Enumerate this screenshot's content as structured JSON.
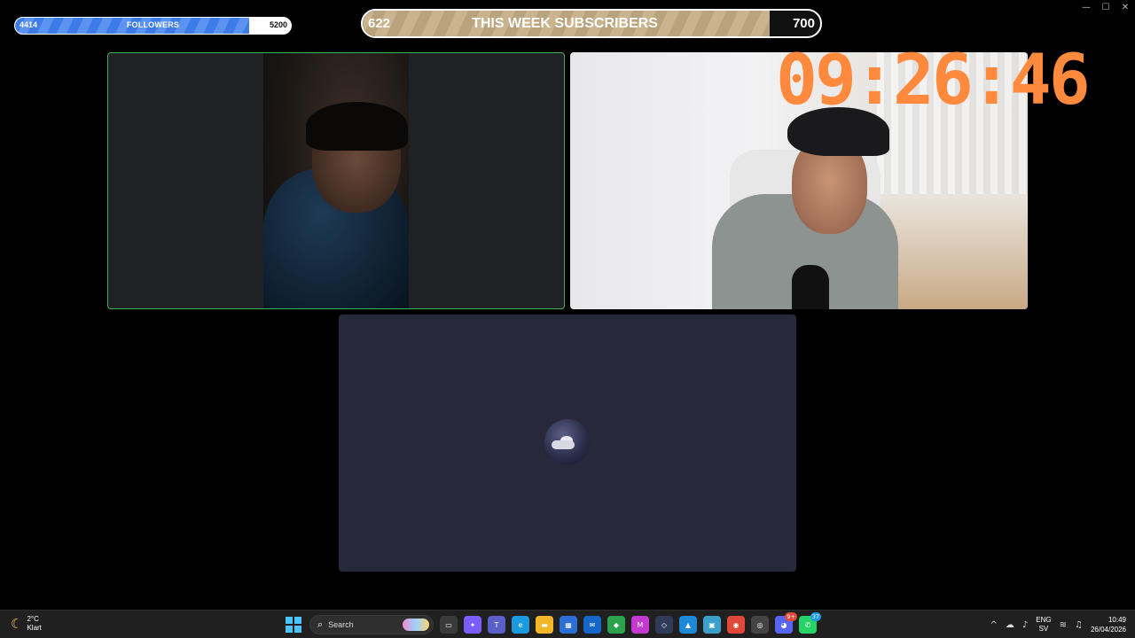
{
  "window": {
    "minimize": "—",
    "maximize": "☐",
    "close": "✕"
  },
  "followers_goal": {
    "current": "4414",
    "title": "FOLLOWERS",
    "target": "5200",
    "progress": 0.849
  },
  "subscribers_goal": {
    "current": "622",
    "title": "THIS WEEK SUBSCRIBERS",
    "target": "700",
    "progress": 0.889
  },
  "timer": {
    "value": "09:26:46",
    "color": "#ff8a3d"
  },
  "colors": {
    "active_speaker_border": "#3bb25a",
    "followers_fill": "#3d7be6",
    "subs_fill": "#c9b48f",
    "tile_bottom": "#272839"
  },
  "taskbar": {
    "weather": {
      "temp": "2°C",
      "condition": "Klart",
      "icon": "moon-icon"
    },
    "search_label": "Search",
    "apps": [
      {
        "name": "task-view-icon",
        "glyph": "▭",
        "color": "#3a3a3a",
        "badge": ""
      },
      {
        "name": "copilot-icon",
        "glyph": "✦",
        "color": "#7a5cff",
        "badge": ""
      },
      {
        "name": "teams-icon",
        "glyph": "T",
        "color": "#5b5fc7",
        "badge": ""
      },
      {
        "name": "edge-icon",
        "glyph": "e",
        "color": "#1a9be0",
        "badge": ""
      },
      {
        "name": "file-explorer-icon",
        "glyph": "▬",
        "color": "#f2b728",
        "badge": ""
      },
      {
        "name": "store-icon",
        "glyph": "▦",
        "color": "#2b6fd6",
        "badge": ""
      },
      {
        "name": "mail-icon",
        "glyph": "✉",
        "color": "#1466c8",
        "badge": ""
      },
      {
        "name": "vpn-icon",
        "glyph": "◆",
        "color": "#2ca24c",
        "badge": ""
      },
      {
        "name": "m365-icon",
        "glyph": "M",
        "color": "#c43ad0",
        "badge": ""
      },
      {
        "name": "dev-tool-icon",
        "glyph": "◇",
        "color": "#2f3b58",
        "badge": ""
      },
      {
        "name": "photos-icon",
        "glyph": "▲",
        "color": "#1e88d8",
        "badge": ""
      },
      {
        "name": "gallery-icon",
        "glyph": "▣",
        "color": "#3aa0c9",
        "badge": ""
      },
      {
        "name": "chrome-icon",
        "glyph": "◉",
        "color": "#e0493a",
        "badge": ""
      },
      {
        "name": "obs-icon",
        "glyph": "◎",
        "color": "#444",
        "badge": ""
      },
      {
        "name": "discord-icon",
        "glyph": "◕",
        "color": "#5865f2",
        "badge": "9+"
      },
      {
        "name": "whatsapp-icon",
        "glyph": "✆",
        "color": "#25d366",
        "badge": "37"
      }
    ],
    "tray": {
      "chevron": "^",
      "language": "ENG",
      "layout": "SV",
      "time": "10:49",
      "date": "26/04/2026"
    }
  }
}
